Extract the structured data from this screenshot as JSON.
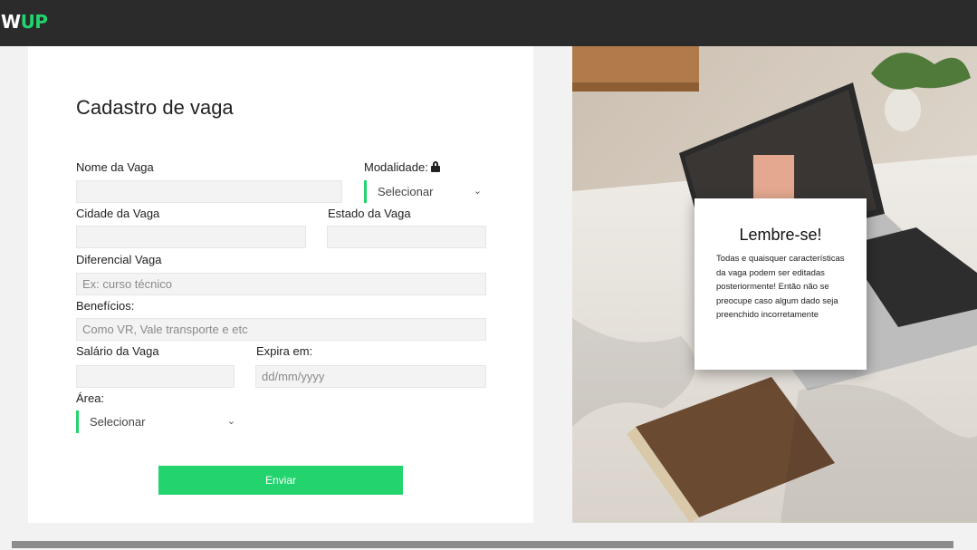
{
  "header": {
    "logo_w": "W",
    "logo_up": "UP",
    "accent_color": "#22d36e",
    "bar_color": "#2b2b2b"
  },
  "form": {
    "title": "Cadastro de vaga",
    "nome_vaga": {
      "label": "Nome da Vaga",
      "value": "",
      "placeholder": ""
    },
    "modalidade": {
      "label": "Modalidade:",
      "selected": "Selecionar",
      "icon": "lock-icon"
    },
    "cidade": {
      "label": "Cidade da Vaga",
      "value": ""
    },
    "estado": {
      "label": "Estado da Vaga",
      "value": ""
    },
    "diferencial": {
      "label": "Diferencial Vaga",
      "placeholder": "Ex: curso técnico"
    },
    "beneficios": {
      "label": "Benefícios:",
      "placeholder": "Como VR, Vale transporte e etc"
    },
    "salario": {
      "label": "Salário da Vaga",
      "value": ""
    },
    "expira": {
      "label": "Expira em:",
      "placeholder": "dd/mm/yyyy"
    },
    "area": {
      "label": "Área:",
      "selected": "Selecionar"
    },
    "submit_label": "Enviar"
  },
  "reminder": {
    "title": "Lembre-se!",
    "text": "Todas e quaisquer características da vaga podem ser editadas posteriormente! Então não se preocupe caso algum dado seja preenchido incorretamente"
  }
}
